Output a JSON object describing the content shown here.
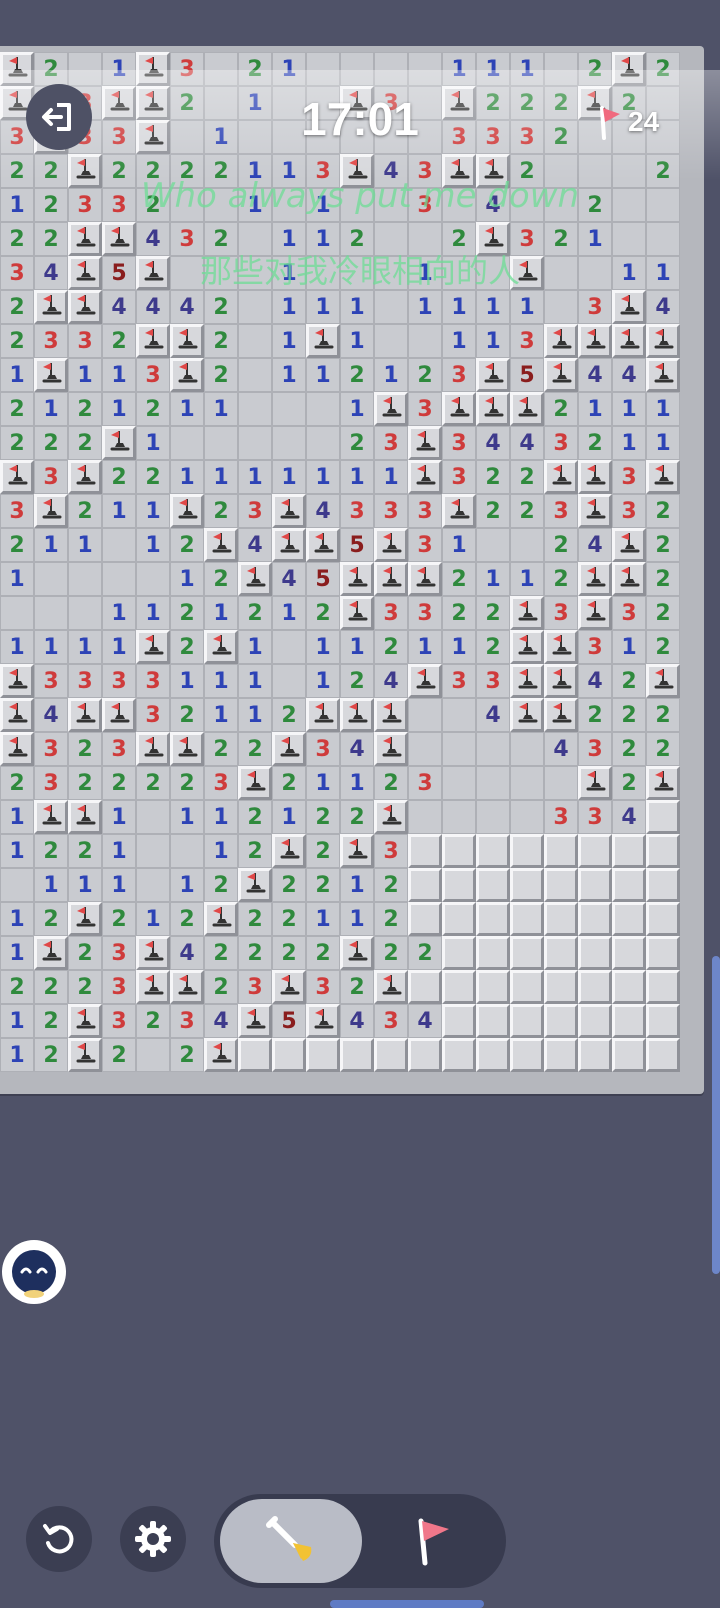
{
  "header": {
    "timer": "17:01",
    "flag_count": "24"
  },
  "lyrics": {
    "line1": "Who always put me down",
    "line2": "那些对我冷眼相向的人"
  },
  "board": {
    "rows": [
      "F2 1F3 21    111 2F2  2F2",
      "F33FF2 1  F3 F222F2   F3",
      "3F33F 1      3332      2F",
      "22F2222113F43FF2   22",
      "12332  1 1  3 4  2   1F",
      "22FF432 112  2F321   11",
      "34F5F   1   1  F  111",
      "2FF4442 111 1111 3F42",
      "2332FF2 1F1  113FFFF",
      "1F113F2 112123F5F44F",
      "2121211   1F3FFF2111",
      "222F1     23F3443211",
      "F3F221111111F322FF3F1",
      "3F211F23F4333F223F32",
      "211 12F4FF5F31  24F2",
      "1    12F45FFF2112FF2",
      "   1121212F3322F3F3221",
      "1111F2F1 112112FF3122",
      "F3333111 124F33FF42FF",
      "F4FF32112FFF  4FF222",
      "F323FF22F34F    4322",
      "2322223F21123    F2FF",
      "1FF1 112122F    334",
      "1221  12F2F3",
      " 111 12F2212",
      "12F212F22112",
      "1F23F42222F22",
      "2223FF23F32F",
      "12F3234F5F434",
      "12F2 2F"
    ]
  }
}
